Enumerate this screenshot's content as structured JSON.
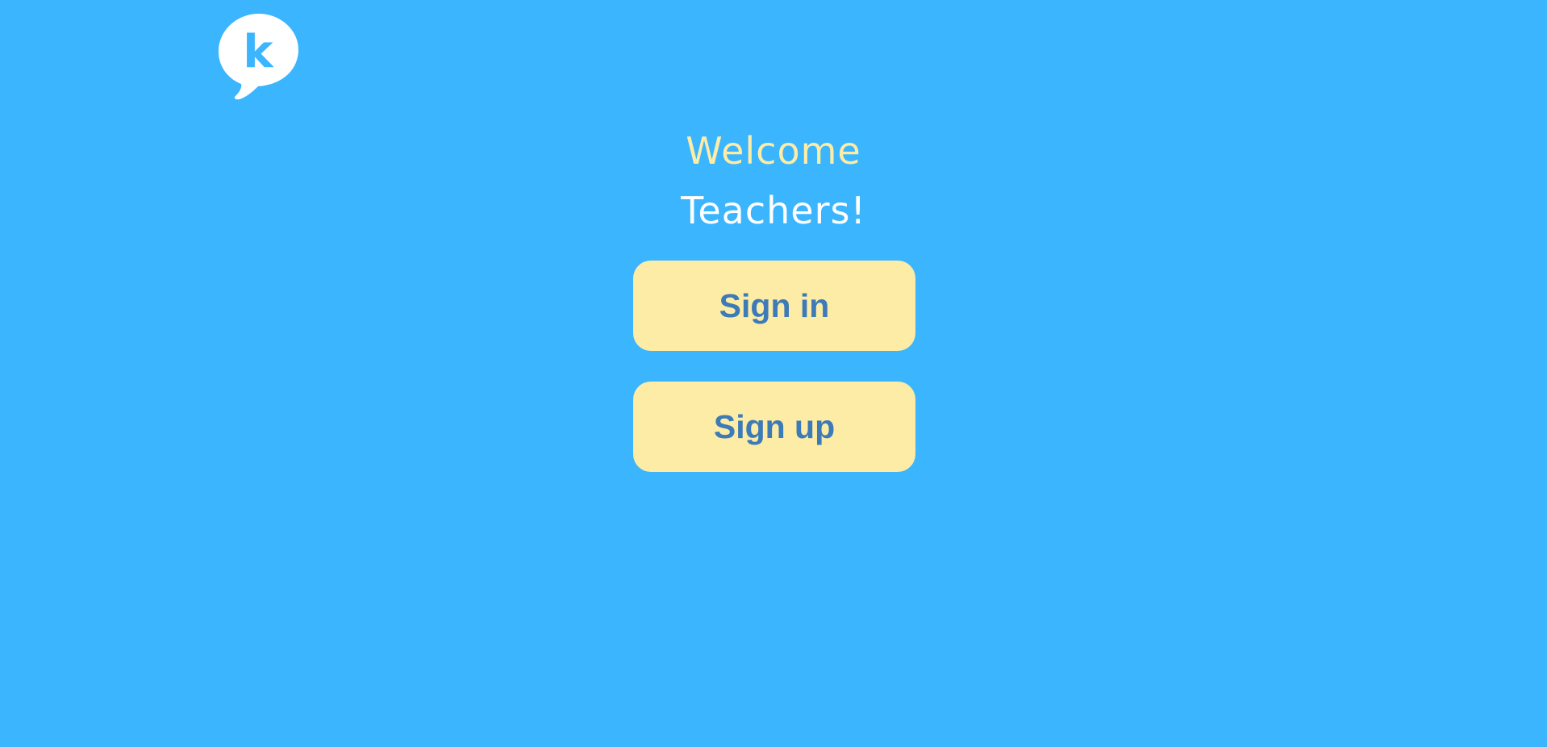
{
  "logo": {
    "icon": "speech-bubble-k-logo",
    "letter": "k"
  },
  "welcome": {
    "line1": "Welcome",
    "line2": "Teachers!"
  },
  "buttons": {
    "sign_in": "Sign in",
    "sign_up": "Sign up"
  },
  "colors": {
    "background": "#3AB5FE",
    "button_bg": "#FDECA6",
    "button_text": "#3D7AB8",
    "welcome_accent": "#FDECA6",
    "welcome_text": "#FFFFFF"
  }
}
